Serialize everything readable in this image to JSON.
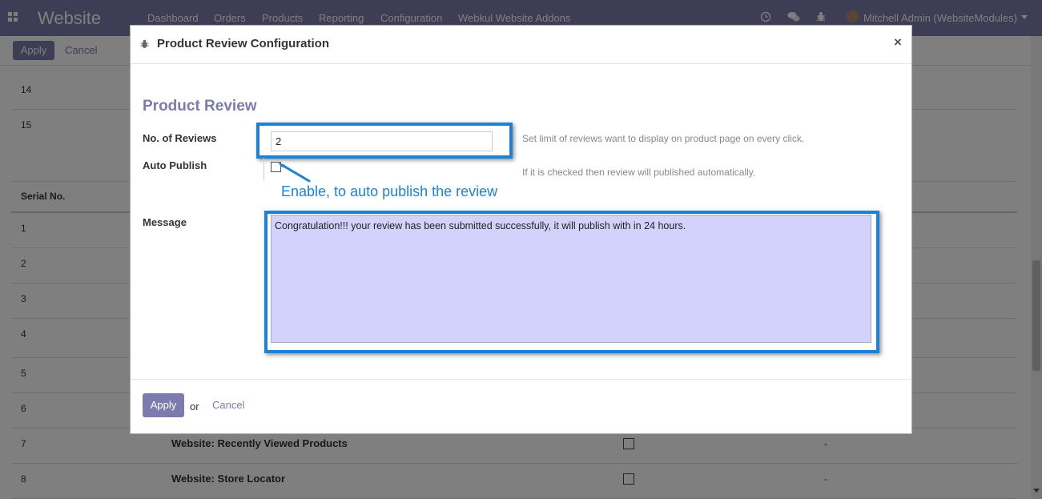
{
  "navbar": {
    "brand": "Website",
    "menu": [
      "Dashboard",
      "Orders",
      "Products",
      "Reporting",
      "Configuration",
      "Webkul Website Addons"
    ],
    "user": "Mitchell Admin (WebsiteModules)",
    "icons": [
      "apps-icon",
      "clock-icon",
      "chat-icon",
      "bug-icon",
      "caret-down-icon"
    ]
  },
  "control_panel": {
    "apply": "Apply",
    "cancel": "Cancel"
  },
  "background": {
    "rows_top": [
      "14",
      "15"
    ],
    "header": "Serial No.",
    "rows": [
      {
        "num": "1"
      },
      {
        "num": "2"
      },
      {
        "num": "3"
      },
      {
        "num": "4"
      },
      {
        "num": "5"
      },
      {
        "num": "6"
      },
      {
        "num": "7",
        "name": "Website: Recently Viewed Products",
        "dash": "-"
      },
      {
        "num": "8",
        "name": "Website: Store Locator",
        "dash": "-"
      }
    ]
  },
  "modal": {
    "title": "Product Review Configuration",
    "close": "×",
    "section": "Product Review",
    "reviews_label": "No. of Reviews",
    "reviews_value": "2",
    "reviews_help": "Set limit of reviews want to display on product page on every click.",
    "auto_publish_label": "Auto Publish",
    "auto_publish_checked": false,
    "auto_publish_help": "If it is checked then review will published automatically.",
    "callout": "Enable, to auto publish the review",
    "message_label": "Message",
    "message_value": "Congratulation!!! your review has been submitted successfully, it will publish with in 24 hours.",
    "apply": "Apply",
    "or": "or",
    "cancel": "Cancel"
  },
  "colors": {
    "brand": "#7c7bad",
    "highlight": "#1c82d6",
    "textarea_bg": "#d3d2fc"
  }
}
